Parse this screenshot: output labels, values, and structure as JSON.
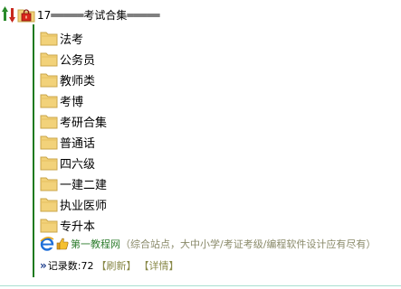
{
  "root": {
    "title": "17═════考试合集═════"
  },
  "folders": [
    {
      "label": "法考"
    },
    {
      "label": "公务员"
    },
    {
      "label": "教师类"
    },
    {
      "label": "考博"
    },
    {
      "label": "考研合集"
    },
    {
      "label": "普通话"
    },
    {
      "label": "四六级"
    },
    {
      "label": "一建二建"
    },
    {
      "label": "执业医师"
    },
    {
      "label": "专升本"
    }
  ],
  "footer_link": {
    "text": "第一教程网",
    "description": "（综合站点，大中小学/考证考级/编程软件设计应有尽有）"
  },
  "record": {
    "text": "记录数:72",
    "refresh": "【刷新】",
    "details": "【详情】"
  },
  "icons": {
    "sort": "sort-icon",
    "locked_folder": "locked-folder-icon",
    "folder": "folder-icon",
    "browser": "ie-icon",
    "thumb": "thumbs-up-icon",
    "arrow": "double-chevron-right-icon"
  },
  "colors": {
    "tree_line": "#1e7a1e",
    "folder_yellow": "#f2d27a",
    "link_green": "#2e7d2e",
    "desc_gray": "#8a8a6a"
  }
}
